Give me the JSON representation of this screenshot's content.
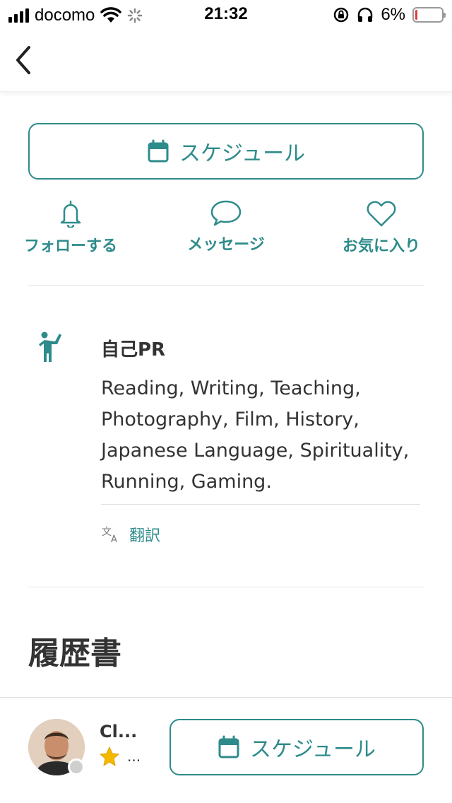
{
  "status_bar": {
    "carrier": "docomo",
    "time": "21:32",
    "battery_percent": "6%",
    "battery_level": 0.06,
    "icons": [
      "signal-icon",
      "wifi-icon",
      "loading-icon",
      "rotation-lock-icon",
      "headphones-icon",
      "battery-icon"
    ]
  },
  "nav": {
    "back_icon": "chevron-left-icon"
  },
  "schedule_button": {
    "label": "スケジュール",
    "icon": "calendar-icon"
  },
  "actions": [
    {
      "label": "フォローする",
      "icon": "bell-icon"
    },
    {
      "label": "メッセージ",
      "icon": "chat-bubble-icon"
    },
    {
      "label": "お気に入り",
      "icon": "heart-icon"
    }
  ],
  "self_pr": {
    "icon": "person-waving-icon",
    "title": "自己PR",
    "body": "Reading, Writing, Teaching, Photography, Film, History, Japanese Language, Spirituality, Running, Gaming.",
    "translate_label": "翻訳",
    "translate_icon": "translate-icon"
  },
  "resume": {
    "title": "履歴書"
  },
  "bottom_bar": {
    "tutor_name": "Cl...",
    "rating_text": "...",
    "rating_icon": "star-icon",
    "schedule_label": "スケジュール"
  },
  "colors": {
    "accent": "#2e8b8b",
    "text": "#333333",
    "battery_low": "#e23b3b",
    "star": "#f5b800"
  }
}
